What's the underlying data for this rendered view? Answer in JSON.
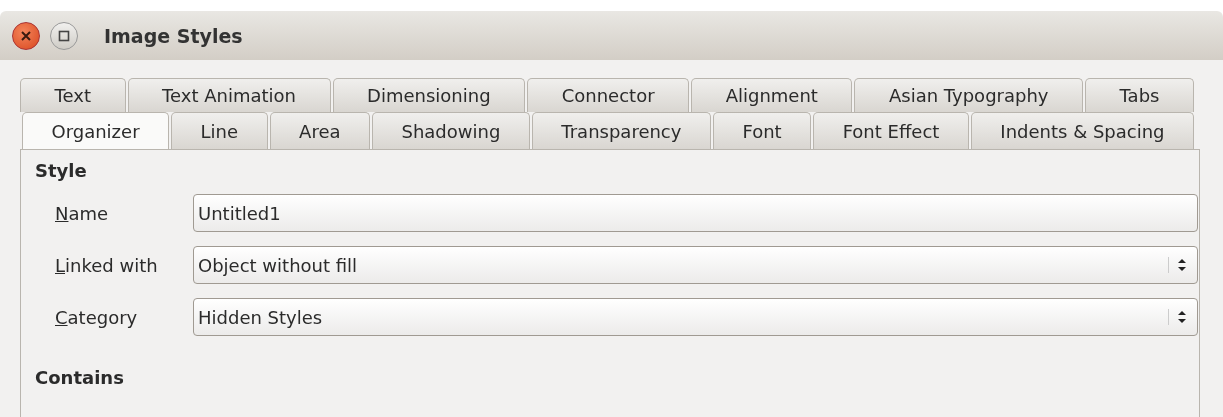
{
  "window": {
    "title": "Image Styles"
  },
  "tab_rows": [
    {
      "tabs": [
        {
          "label": "Text",
          "selected": false
        },
        {
          "label": "Text Animation",
          "selected": false
        },
        {
          "label": "Dimensioning",
          "selected": false
        },
        {
          "label": "Connector",
          "selected": false
        },
        {
          "label": "Alignment",
          "selected": false
        },
        {
          "label": "Asian Typography",
          "selected": false
        },
        {
          "label": "Tabs",
          "selected": false
        }
      ]
    },
    {
      "tabs": [
        {
          "label": "Organizer",
          "selected": true
        },
        {
          "label": "Line",
          "selected": false
        },
        {
          "label": "Area",
          "selected": false
        },
        {
          "label": "Shadowing",
          "selected": false
        },
        {
          "label": "Transparency",
          "selected": false
        },
        {
          "label": "Font",
          "selected": false
        },
        {
          "label": "Font Effect",
          "selected": false
        },
        {
          "label": "Indents & Spacing",
          "selected": false
        }
      ]
    }
  ],
  "style_section": {
    "heading": "Style",
    "fields": [
      {
        "kind": "text",
        "label_key": "N",
        "label_rest": "ame",
        "value": "Untitled1"
      },
      {
        "kind": "spin",
        "label_key": "L",
        "label_rest": "inked with",
        "value": "Object without fill"
      },
      {
        "kind": "spin",
        "label_key": "C",
        "label_rest": "ategory",
        "value": "Hidden Styles"
      }
    ]
  },
  "contains_section": {
    "heading": "Contains"
  }
}
